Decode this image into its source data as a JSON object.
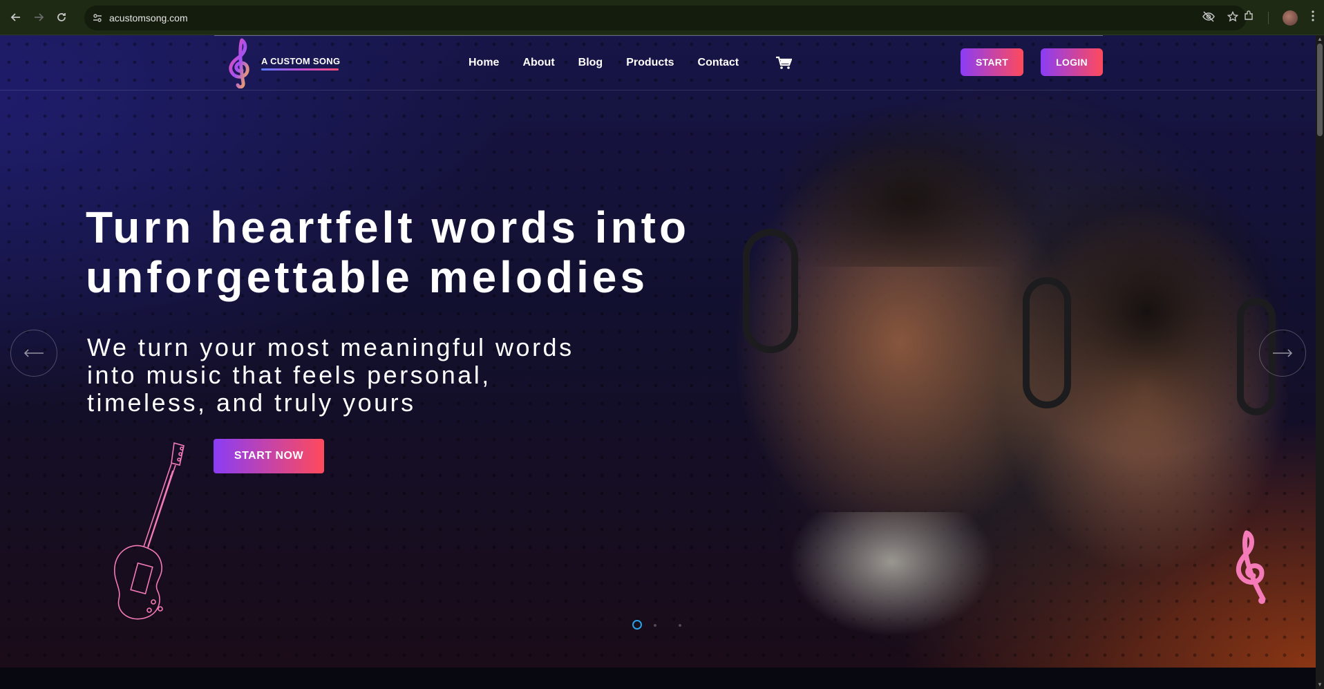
{
  "browser": {
    "url": "acustomsong.com",
    "icons": [
      "back-icon",
      "forward-icon",
      "reload-icon",
      "site-settings-icon",
      "eye-off-icon",
      "star-icon",
      "extensions-icon",
      "profile-avatar",
      "menu-icon"
    ]
  },
  "header": {
    "logo_title": "A CUSTOM SONG",
    "nav": [
      "Home",
      "About",
      "Blog",
      "Products",
      "Contact"
    ],
    "start_label": "START",
    "login_label": "LOGIN"
  },
  "hero": {
    "headline_line1": "Turn heartfelt words into",
    "headline_line2": "unforgettable melodies",
    "sub_line1": "We turn your most meaningful words",
    "sub_line2": "into music that feels personal,",
    "sub_line3": "timeless, and truly yours",
    "cta_label": "START NOW"
  },
  "colors": {
    "accent_start": "#8a3df5",
    "accent_end": "#ff4a5c",
    "pink": "#f47ab8",
    "carousel_indicator": "#29a3e6"
  }
}
